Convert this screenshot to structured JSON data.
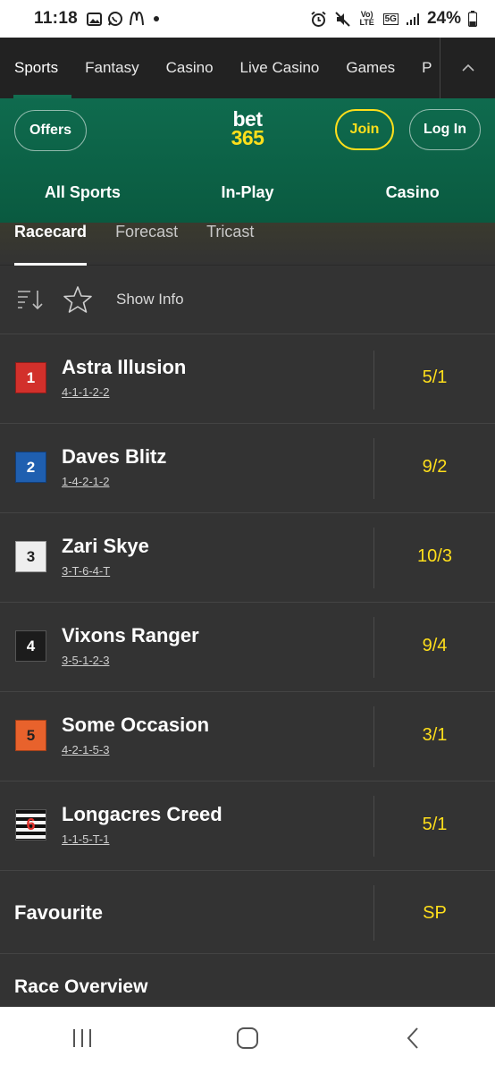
{
  "status_bar": {
    "time": "11:18",
    "network_labels": [
      "Vo) LTE",
      "5G"
    ],
    "battery_percent": "24%"
  },
  "top_nav": {
    "tabs": [
      "Sports",
      "Fantasy",
      "Casino",
      "Live Casino",
      "Games",
      "P"
    ],
    "active": "Sports"
  },
  "header": {
    "offers_label": "Offers",
    "logo_top": "bet",
    "logo_bottom": "365",
    "join_label": "Join",
    "login_label": "Log In",
    "sub_nav": [
      "All Sports",
      "In-Play",
      "Casino"
    ]
  },
  "race_tabs": {
    "tabs": [
      "Racecard",
      "Forecast",
      "Tricast"
    ],
    "active": "Racecard"
  },
  "toolbar": {
    "show_info_label": "Show Info"
  },
  "runners": [
    {
      "number": "1",
      "name": "Astra Illusion",
      "form": "4-1-1-2-2",
      "odds": "5/1",
      "silk_color": "#d2302b",
      "silk_text": "#ffffff"
    },
    {
      "number": "2",
      "name": "Daves Blitz",
      "form": "1-4-2-1-2",
      "odds": "9/2",
      "silk_color": "#1f5fb0",
      "silk_text": "#ffffff"
    },
    {
      "number": "3",
      "name": "Zari Skye",
      "form": "3-T-6-4-T",
      "odds": "10/3",
      "silk_color": "#eeeeee",
      "silk_text": "#222222"
    },
    {
      "number": "4",
      "name": "Vixons Ranger",
      "form": "3-5-1-2-3",
      "odds": "9/4",
      "silk_color": "#1c1c1c",
      "silk_text": "#ffffff"
    },
    {
      "number": "5",
      "name": "Some Occasion",
      "form": "4-2-1-5-3",
      "odds": "3/1",
      "silk_color": "#e8622c",
      "silk_text": "#222222"
    },
    {
      "number": "6",
      "name": "Longacres Creed",
      "form": "1-1-5-T-1",
      "odds": "5/1",
      "silk_color": "striped",
      "silk_text": "#e0302b"
    }
  ],
  "favourite": {
    "label": "Favourite",
    "odds": "SP"
  },
  "race_overview_label": "Race Overview",
  "colors": {
    "brand_green": "#126e51",
    "brand_yellow": "#ffdf1b",
    "background": "#333333"
  }
}
